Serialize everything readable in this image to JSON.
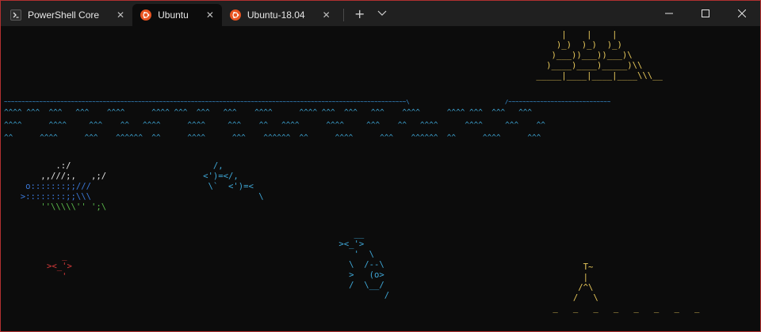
{
  "tabs": [
    {
      "label": "PowerShell Core",
      "icon": "powershell-icon",
      "active": false
    },
    {
      "label": "Ubuntu",
      "icon": "ubuntu-icon",
      "active": true
    },
    {
      "label": "Ubuntu-18.04",
      "icon": "ubuntu-icon",
      "active": false
    }
  ],
  "titlebar": {
    "new_tab": "+",
    "dropdown": "⌵",
    "minimize": "—",
    "maximize": "☐",
    "close": "✕",
    "tab_close": "✕"
  },
  "colors": {
    "window_border": "#b03030",
    "titlebar_bg": "#202020",
    "terminal_bg": "#0c0c0c",
    "ubuntu_orange": "#e95420",
    "water": "#3a96dd",
    "ship": "#e8c85a"
  },
  "terminal": {
    "ship": "              |    |    |\n             )_)  )_)  )_)\n            )___))___))___)\\\n           )____)____)_____)\\\\\n         _____|____|____|____\\\\\\__",
    "waterline": "~~~~~~~~~~~~~~~~~~~~~~~~~~~~~~~~~~~~~~~~~~~~~~~~~~~~~~~~~~~~~~~~~~~~~~~~~~~~~~~~~~~~~~~~~~~~~~~~~~~~~~~~~~~~~~~~~~\\                           /~~~~~~~~~~~~~~~~~~~~~~~~~~~~~",
    "waves1": "^^^^ ^^^  ^^^   ^^^    ^^^^      ^^^^ ^^^  ^^^   ^^^    ^^^^      ^^^^ ^^^  ^^^   ^^^    ^^^^      ^^^^ ^^^  ^^^   ^^^",
    "waves2": "^^^^      ^^^^     ^^^    ^^   ^^^^      ^^^^     ^^^    ^^   ^^^^      ^^^^     ^^^    ^^   ^^^^      ^^^^     ^^^    ^^",
    "waves3": "^^      ^^^^      ^^^    ^^^^^^  ^^      ^^^^      ^^^    ^^^^^^  ^^      ^^^^      ^^^    ^^^^^^  ^^      ^^^^      ^^^",
    "bigfish_top": "         .:/\n      ,,///;,   ,;/",
    "bigfish_mid": "   o:::::::;;///\n  >::::::::;;\\\\\\",
    "bigfish_bottom": "      ''\\\\\\\\\\'' ';\\",
    "fish_small1": "     /,\n   <')=</,\n    \\`  <')=<\n              \\",
    "fish_small2": "   _\n><_'>\n   '",
    "penguin": "    __\n ><_'>\n    '  \\\n   \\  /--\\\n   >   (o>\n   /  \\__/\n          /",
    "castle": "       T~\n       |\n      /^\\\n     /   \\\n _   _   _   _   _   _   _   _"
  }
}
